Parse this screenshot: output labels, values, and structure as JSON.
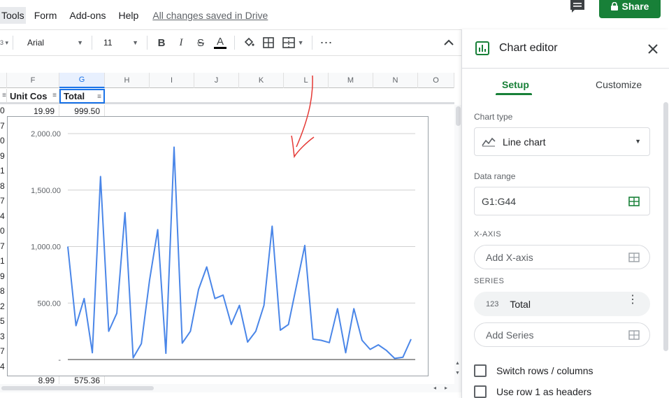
{
  "menu": {
    "items": [
      "Tools",
      "Form",
      "Add-ons",
      "Help"
    ],
    "saved_status": "All changes saved in Drive"
  },
  "share": {
    "label": "Share"
  },
  "toolbar": {
    "font": "Arial",
    "font_size": "11",
    "bold": "B",
    "italic": "I",
    "strike": "S",
    "text_color": "A"
  },
  "columns": [
    "F",
    "G",
    "H",
    "I",
    "J",
    "K",
    "L",
    "M",
    "N",
    "O"
  ],
  "header_row": {
    "unit_cost": "Unit Cos",
    "total": "Total"
  },
  "row_number_suffixes": [
    "0",
    "7",
    "0",
    "9",
    "1",
    "8",
    "7",
    "4",
    "0",
    "7",
    "1",
    "9",
    "8",
    "2",
    "5",
    "3",
    "7",
    "4"
  ],
  "cells": {
    "f_top": "19.99",
    "g_top": "999.50",
    "f_bottom": "8.99",
    "g_bottom": "575.36"
  },
  "chart_data": {
    "type": "line",
    "title": "",
    "xlabel": "",
    "ylabel": "",
    "ylim": [
      0,
      2000
    ],
    "y_ticks": [
      "2,000.00",
      "1,500.00",
      "1,000.00",
      "500.00",
      "-"
    ],
    "series": [
      {
        "values": [
          1000,
          300,
          540,
          60,
          1620,
          250,
          410,
          1300,
          15,
          140,
          700,
          1150,
          55,
          1880,
          145,
          250,
          620,
          820,
          540,
          570,
          310,
          480,
          155,
          250,
          480,
          1180,
          260,
          310,
          660,
          1010,
          180,
          170,
          150,
          450,
          60,
          450,
          170,
          90,
          130,
          80,
          10,
          20,
          180
        ]
      }
    ],
    "color": "#4a86e8",
    "grid": true
  },
  "editor": {
    "title": "Chart editor",
    "tabs": [
      "Setup",
      "Customize"
    ],
    "chart_type_label": "Chart type",
    "chart_type_value": "Line chart",
    "data_range_label": "Data range",
    "data_range_value": "G1:G44",
    "x_axis_label": "X-AXIS",
    "x_axis_placeholder": "Add X-axis",
    "series_label": "SERIES",
    "series_item": "Total",
    "series_item_prefix": "123",
    "add_series": "Add Series",
    "switch_rows": "Switch rows / columns",
    "use_row_headers": "Use row 1 as headers"
  },
  "colors": {
    "brand_green": "#188038",
    "accent_blue": "#1a73e8",
    "line_blue": "#4a86e8",
    "annotation_red": "#e53935"
  }
}
